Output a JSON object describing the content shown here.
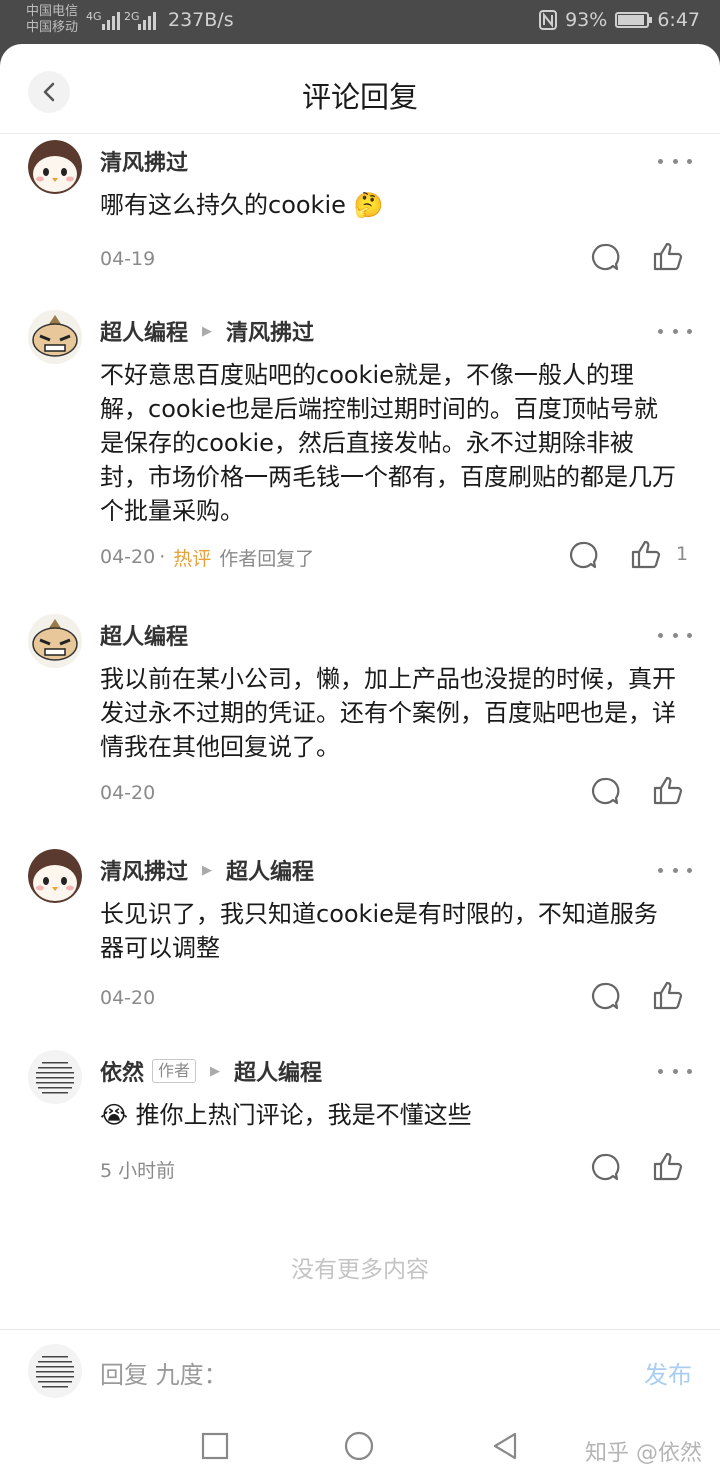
{
  "status_bar": {
    "carrier1": "中国电信",
    "carrier2": "中国移动",
    "net1": "4G",
    "net2": "2G",
    "speed": "237B/s",
    "battery": "93%",
    "battery_level": 0.93,
    "time": "6:47"
  },
  "header": {
    "title": "评论回复",
    "back_icon": "chevron-left-icon"
  },
  "comments": [
    {
      "author": "清风拂过",
      "reply_to": "",
      "is_author": false,
      "text": "哪有这么持久的cookie 🤔",
      "date": "04-19",
      "hot": "",
      "note": "",
      "likes": ""
    },
    {
      "author": "超人编程",
      "reply_to": "清风拂过",
      "is_author": false,
      "text": "不好意思百度贴吧的cookie就是，不像一般人的理解，cookie也是后端控制过期时间的。百度顶帖号就是保存的cookie，然后直接发帖。永不过期除非被封，市场价格一两毛钱一个都有，百度刷贴的都是几万个批量采购。",
      "date": "04-20",
      "hot": "热评",
      "note": "作者回复了",
      "likes": "1"
    },
    {
      "author": "超人编程",
      "reply_to": "",
      "is_author": false,
      "text": "我以前在某小公司，懒，加上产品也没提的时候，真开发过永不过期的凭证。还有个案例，百度贴吧也是，详情我在其他回复说了。",
      "date": "04-20",
      "hot": "",
      "note": "",
      "likes": ""
    },
    {
      "author": "清风拂过",
      "reply_to": "超人编程",
      "is_author": false,
      "text": "长见识了，我只知道cookie是有时限的，不知道服务器可以调整",
      "date": "04-20",
      "hot": "",
      "note": "",
      "likes": ""
    },
    {
      "author": "依然",
      "author_tag": "作者",
      "reply_to": "超人编程",
      "is_author": true,
      "text": "😭 推你上热门评论，我是不懂这些",
      "date": "5 小时前",
      "hot": "",
      "note": "",
      "likes": ""
    }
  ],
  "no_more": "没有更多内容",
  "input_bar": {
    "placeholder": "回复 九度：",
    "publish": "发布"
  },
  "watermark": "知乎 @依然",
  "colors": {
    "hot": "#e5a13b",
    "publish": "#a9cdf3",
    "text": "#1a1a1a",
    "meta": "#8a8a8a"
  }
}
